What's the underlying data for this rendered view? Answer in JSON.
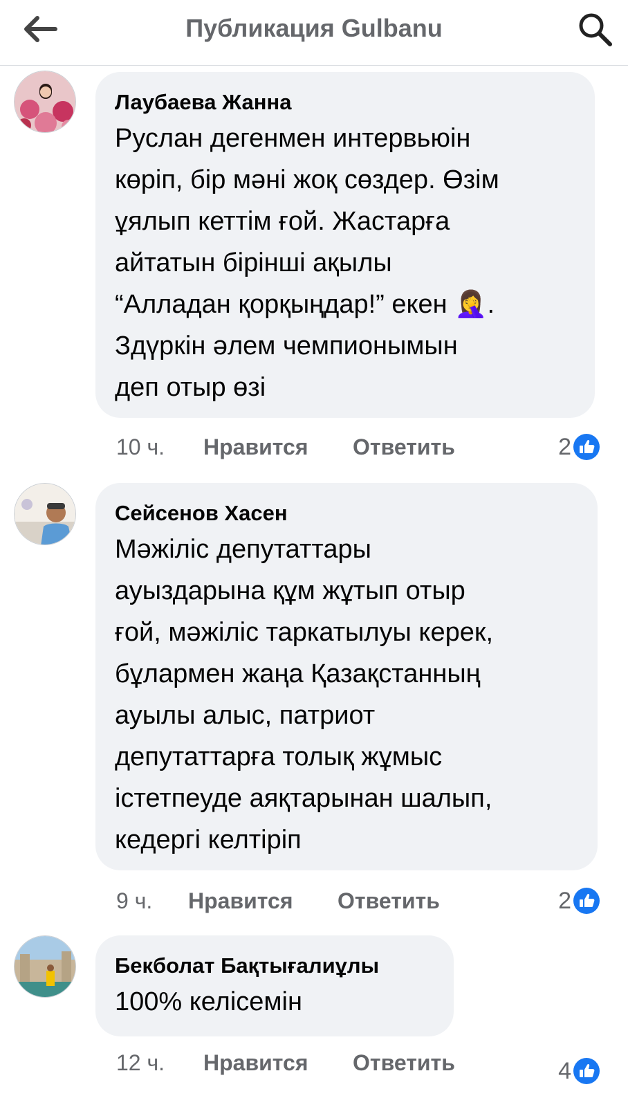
{
  "header": {
    "title": "Публикация Gulbanu"
  },
  "comments": [
    {
      "author": "Лаубаева Жанна",
      "text": "Руслан дегенмен интервьюін\nкөріп, бір мәні жоқ сөздер. Өзім\nұялып кеттім ғой. Жастарға\nайтатын бірінші ақылы\n“Алладан қорқыңдар!” екен 🤦‍♀️.\nЗдүркін әлем чемпионымын\nдеп отыр өзі",
      "time": "10 ч.",
      "like_label": "Нравится",
      "reply_label": "Ответить",
      "reactions": "2"
    },
    {
      "author": "Сейсенов Хасен",
      "text": "Мәжіліс депутаттары\nауыздарына құм жұтып отыр\nғой,  мәжіліс таркатылуы керек,\nбұлармен жаңа Қазақстанның\nауылы алыс, патриот\nдепутаттарға толық жұмыс\nістетпеуде аяқтарынан шалып,\nкедергі келтіріп",
      "time": "9 ч.",
      "like_label": "Нравится",
      "reply_label": "Ответить",
      "reactions": "2"
    },
    {
      "author": "Бекболат Бақтығалиұлы",
      "text": "100% келісемін",
      "time": "12 ч.",
      "like_label": "Нравится",
      "reply_label": "Ответить",
      "reactions": "4"
    }
  ],
  "colors": {
    "like_blue": "#1877f2",
    "bubble": "#f0f2f5",
    "muted": "#65676b"
  }
}
